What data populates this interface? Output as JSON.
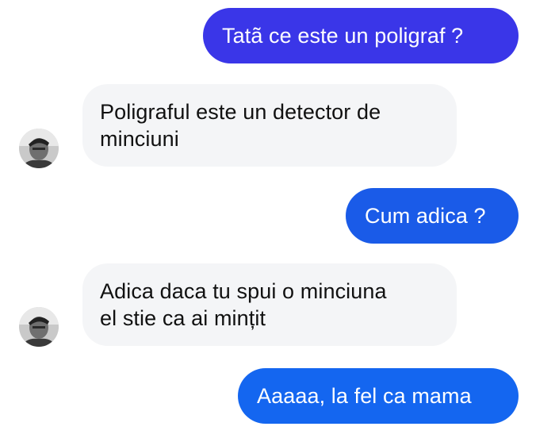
{
  "messages": [
    {
      "sender": "me",
      "text": "Tatã ce este un poligraf ?",
      "color": "#3a36e8"
    },
    {
      "sender": "them",
      "lines": [
        "Poligraful este un detector de",
        "minciuni"
      ]
    },
    {
      "sender": "me",
      "text": "Cum adica ?",
      "color": "#1a5be8"
    },
    {
      "sender": "them",
      "lines": [
        "Adica daca tu spui o minciuna",
        "el stie ca ai mințit"
      ]
    },
    {
      "sender": "me",
      "text": "Aaaaa, la fel ca mama",
      "color": "#1466f0"
    }
  ],
  "colors": {
    "received_bubble": "#f4f5f7",
    "received_text": "#111111",
    "sent_text": "#ffffff"
  },
  "icons": {
    "avatar": "contact-avatar-photo"
  }
}
